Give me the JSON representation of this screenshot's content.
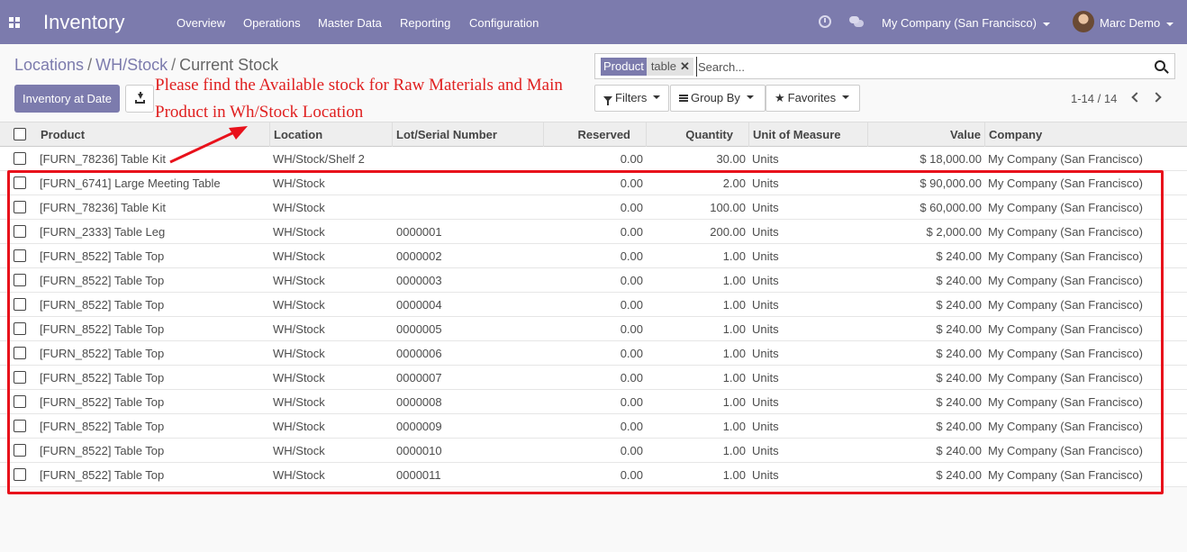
{
  "navbar": {
    "app_title": "Inventory",
    "menu": [
      "Overview",
      "Operations",
      "Master Data",
      "Reporting",
      "Configuration"
    ],
    "company": "My Company (San Francisco)",
    "user": "Marc Demo",
    "icons": [
      "apps-icon",
      "clock-icon",
      "chat-icon"
    ]
  },
  "breadcrumb": [
    "Locations",
    "WH/Stock",
    "Current Stock"
  ],
  "buttons": {
    "inventory_at_date": "Inventory at Date",
    "filters": "Filters",
    "group_by": "Group By",
    "favorites": "Favorites"
  },
  "search": {
    "facet_label": "Product",
    "facet_value": "table",
    "placeholder": "Search..."
  },
  "pager": "1-14 / 14",
  "annotation": {
    "line1": "Please find the Available stock for Raw Materials and Main",
    "line2": "Product in Wh/Stock Location",
    "color": "#e02020"
  },
  "table": {
    "columns": [
      "Product",
      "Location",
      "Lot/Serial Number",
      "Reserved",
      "Quantity",
      "Unit of Measure",
      "Value",
      "Company"
    ],
    "rows": [
      [
        "[FURN_78236] Table Kit",
        "WH/Stock/Shelf 2",
        "",
        "0.00",
        "30.00",
        "Units",
        "$ 18,000.00",
        "My Company (San Francisco)"
      ],
      [
        "[FURN_6741] Large Meeting Table",
        "WH/Stock",
        "",
        "0.00",
        "2.00",
        "Units",
        "$ 90,000.00",
        "My Company (San Francisco)"
      ],
      [
        "[FURN_78236] Table Kit",
        "WH/Stock",
        "",
        "0.00",
        "100.00",
        "Units",
        "$ 60,000.00",
        "My Company (San Francisco)"
      ],
      [
        "[FURN_2333] Table Leg",
        "WH/Stock",
        "0000001",
        "0.00",
        "200.00",
        "Units",
        "$ 2,000.00",
        "My Company (San Francisco)"
      ],
      [
        "[FURN_8522] Table Top",
        "WH/Stock",
        "0000002",
        "0.00",
        "1.00",
        "Units",
        "$ 240.00",
        "My Company (San Francisco)"
      ],
      [
        "[FURN_8522] Table Top",
        "WH/Stock",
        "0000003",
        "0.00",
        "1.00",
        "Units",
        "$ 240.00",
        "My Company (San Francisco)"
      ],
      [
        "[FURN_8522] Table Top",
        "WH/Stock",
        "0000004",
        "0.00",
        "1.00",
        "Units",
        "$ 240.00",
        "My Company (San Francisco)"
      ],
      [
        "[FURN_8522] Table Top",
        "WH/Stock",
        "0000005",
        "0.00",
        "1.00",
        "Units",
        "$ 240.00",
        "My Company (San Francisco)"
      ],
      [
        "[FURN_8522] Table Top",
        "WH/Stock",
        "0000006",
        "0.00",
        "1.00",
        "Units",
        "$ 240.00",
        "My Company (San Francisco)"
      ],
      [
        "[FURN_8522] Table Top",
        "WH/Stock",
        "0000007",
        "0.00",
        "1.00",
        "Units",
        "$ 240.00",
        "My Company (San Francisco)"
      ],
      [
        "[FURN_8522] Table Top",
        "WH/Stock",
        "0000008",
        "0.00",
        "1.00",
        "Units",
        "$ 240.00",
        "My Company (San Francisco)"
      ],
      [
        "[FURN_8522] Table Top",
        "WH/Stock",
        "0000009",
        "0.00",
        "1.00",
        "Units",
        "$ 240.00",
        "My Company (San Francisco)"
      ],
      [
        "[FURN_8522] Table Top",
        "WH/Stock",
        "0000010",
        "0.00",
        "1.00",
        "Units",
        "$ 240.00",
        "My Company (San Francisco)"
      ],
      [
        "[FURN_8522] Table Top",
        "WH/Stock",
        "0000011",
        "0.00",
        "1.00",
        "Units",
        "$ 240.00",
        "My Company (San Francisco)"
      ]
    ]
  },
  "colors": {
    "brand": "#7c7bad",
    "highlight_box": "#e8111b"
  }
}
